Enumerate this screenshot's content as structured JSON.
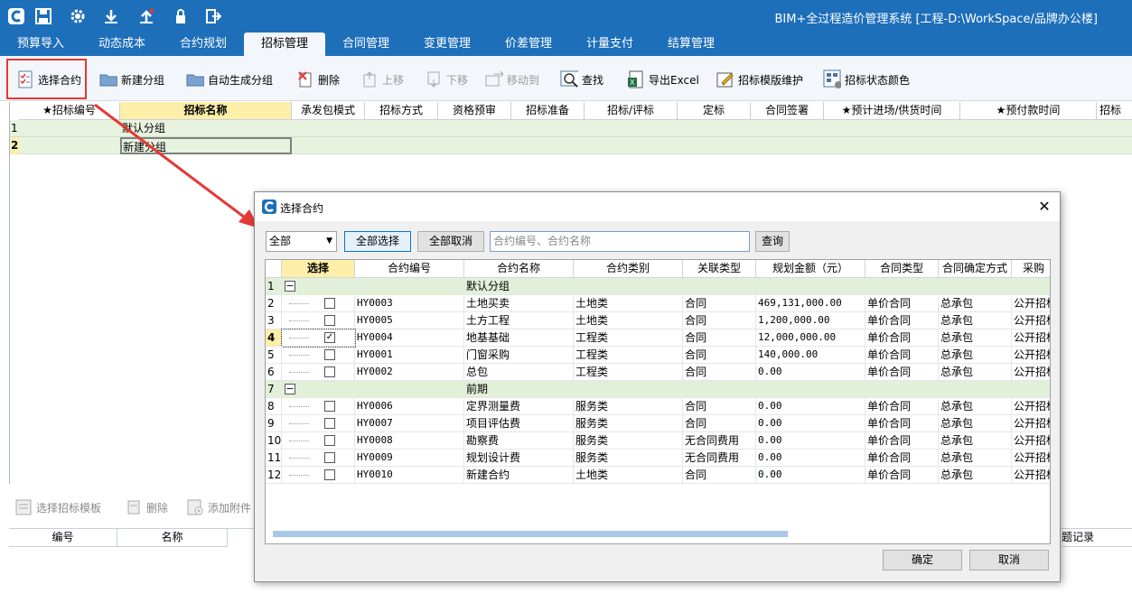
{
  "app_title": "BIM+全过程造价管理系统 [工程-D:\\WorkSpace/品牌办公楼]",
  "menu": [
    "预算导入",
    "动态成本",
    "合约规划",
    "招标管理",
    "合同管理",
    "变更管理",
    "价差管理",
    "计量支付",
    "结算管理"
  ],
  "active_menu": "招标管理",
  "toolbar": {
    "select_contract": "选择合约",
    "new_group": "新建分组",
    "auto_group": "自动生成分组",
    "delete": "删除",
    "move_up": "上移",
    "move_down": "下移",
    "move_to": "移动到",
    "find": "查找",
    "export_excel": "导出Excel",
    "template_maintain": "招标模版维护",
    "status_color": "招标状态颜色"
  },
  "main_grid": {
    "headers": [
      "★招标编号",
      "招标名称",
      "承发包模式",
      "招标方式",
      "资格预审",
      "招标准备",
      "招标/评标",
      "定标",
      "合同签署",
      "★预计进场/供货时间",
      "★预付款时间",
      "招标"
    ],
    "rows": [
      {
        "num": "1",
        "name": "默认分组"
      },
      {
        "num": "2",
        "name": "新建分组"
      }
    ]
  },
  "bottom_toolbar": {
    "select_template": "选择招标模板",
    "delete": "删除",
    "add_attachment": "添加附件"
  },
  "bottom_grid": {
    "headers": [
      "编号",
      "名称"
    ],
    "right_header": "题记录"
  },
  "dialog": {
    "title": "选择合约",
    "filter_value": "全部",
    "select_all": "全部选择",
    "cancel_all": "全部取消",
    "search_placeholder": "合约编号、合约名称",
    "query": "查询",
    "headers": [
      "选择",
      "合约编号",
      "合约名称",
      "合约类别",
      "关联类型",
      "规划金额（元）",
      "合同类型",
      "合同确定方式",
      "采购"
    ],
    "rows": [
      {
        "num": "1",
        "group": "默认分组"
      },
      {
        "num": "2",
        "checked": false,
        "code": "HY0003",
        "name": "土地买卖",
        "category": "土地类",
        "link": "合同",
        "amount": "469,131,000.00",
        "ctype": "单价合同",
        "method": "总承包",
        "purchase": "公开招标"
      },
      {
        "num": "3",
        "checked": false,
        "code": "HY0005",
        "name": "土方工程",
        "category": "土地类",
        "link": "合同",
        "amount": "1,200,000.00",
        "ctype": "单价合同",
        "method": "总承包",
        "purchase": "公开招标"
      },
      {
        "num": "4",
        "checked": true,
        "code": "HY0004",
        "name": "地基基础",
        "category": "工程类",
        "link": "合同",
        "amount": "12,000,000.00",
        "ctype": "单价合同",
        "method": "总承包",
        "purchase": "公开招标"
      },
      {
        "num": "5",
        "checked": false,
        "code": "HY0001",
        "name": "门窗采购",
        "category": "工程类",
        "link": "合同",
        "amount": "140,000.00",
        "ctype": "单价合同",
        "method": "总承包",
        "purchase": "公开招标"
      },
      {
        "num": "6",
        "checked": false,
        "code": "HY0002",
        "name": "总包",
        "category": "工程类",
        "link": "合同",
        "amount": "0.00",
        "ctype": "单价合同",
        "method": "总承包",
        "purchase": "公开招标"
      },
      {
        "num": "7",
        "group": "前期"
      },
      {
        "num": "8",
        "checked": false,
        "code": "HY0006",
        "name": "定界测量费",
        "category": "服务类",
        "link": "合同",
        "amount": "0.00",
        "ctype": "单价合同",
        "method": "总承包",
        "purchase": "公开招标"
      },
      {
        "num": "9",
        "checked": false,
        "code": "HY0007",
        "name": "项目评估费",
        "category": "服务类",
        "link": "合同",
        "amount": "0.00",
        "ctype": "单价合同",
        "method": "总承包",
        "purchase": "公开招标"
      },
      {
        "num": "10",
        "checked": false,
        "code": "HY0008",
        "name": "勘察费",
        "category": "服务类",
        "link": "无合同费用",
        "amount": "0.00",
        "ctype": "单价合同",
        "method": "总承包",
        "purchase": "公开招标"
      },
      {
        "num": "11",
        "checked": false,
        "code": "HY0009",
        "name": "规划设计费",
        "category": "服务类",
        "link": "无合同费用",
        "amount": "0.00",
        "ctype": "单价合同",
        "method": "总承包",
        "purchase": "公开招标"
      },
      {
        "num": "12",
        "checked": false,
        "code": "HY0010",
        "name": "新建合约",
        "category": "土地类",
        "link": "合同",
        "amount": "0.00",
        "ctype": "单价合同",
        "method": "总承包",
        "purchase": "公开招标"
      }
    ],
    "ok": "确定",
    "cancel": "取消"
  },
  "colors": {
    "titlebar": "#1d6fba",
    "highlight": "#e53935",
    "group_row": "#e3f0d9",
    "header_selected": "#fdeea8"
  }
}
